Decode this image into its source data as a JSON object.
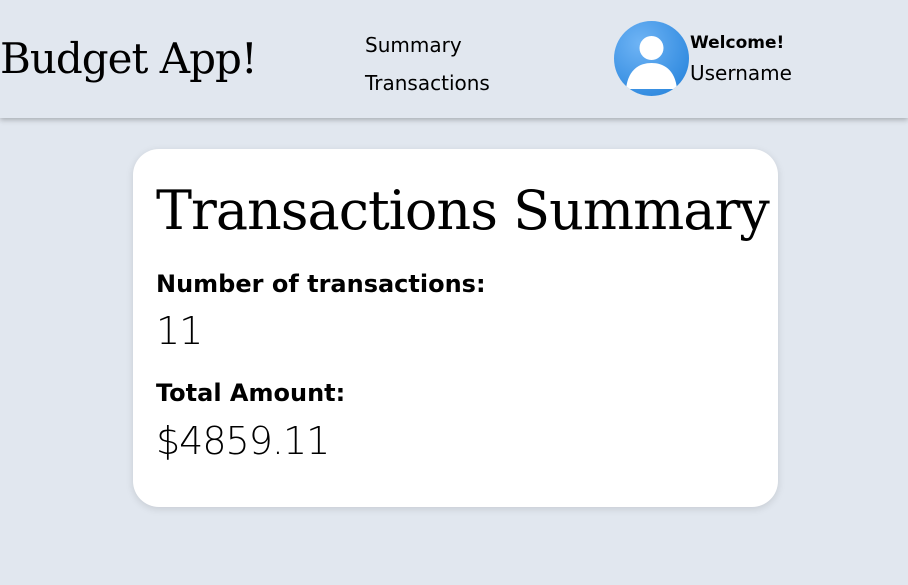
{
  "header": {
    "brand": "Budget App!",
    "nav": [
      {
        "label": "Summary"
      },
      {
        "label": "Transactions"
      }
    ],
    "profile": {
      "greeting": "Welcome!",
      "username": "Username",
      "avatar_icon": "user-avatar-icon"
    }
  },
  "summary": {
    "title": "Transactions Summary",
    "count_label": "Number of transactions:",
    "count_value": "11",
    "total_label": "Total Amount:",
    "total_value": "$4859.11"
  },
  "colors": {
    "background": "#e1e7ef",
    "card": "#ffffff",
    "avatar_blue": "#2a8ae3"
  }
}
